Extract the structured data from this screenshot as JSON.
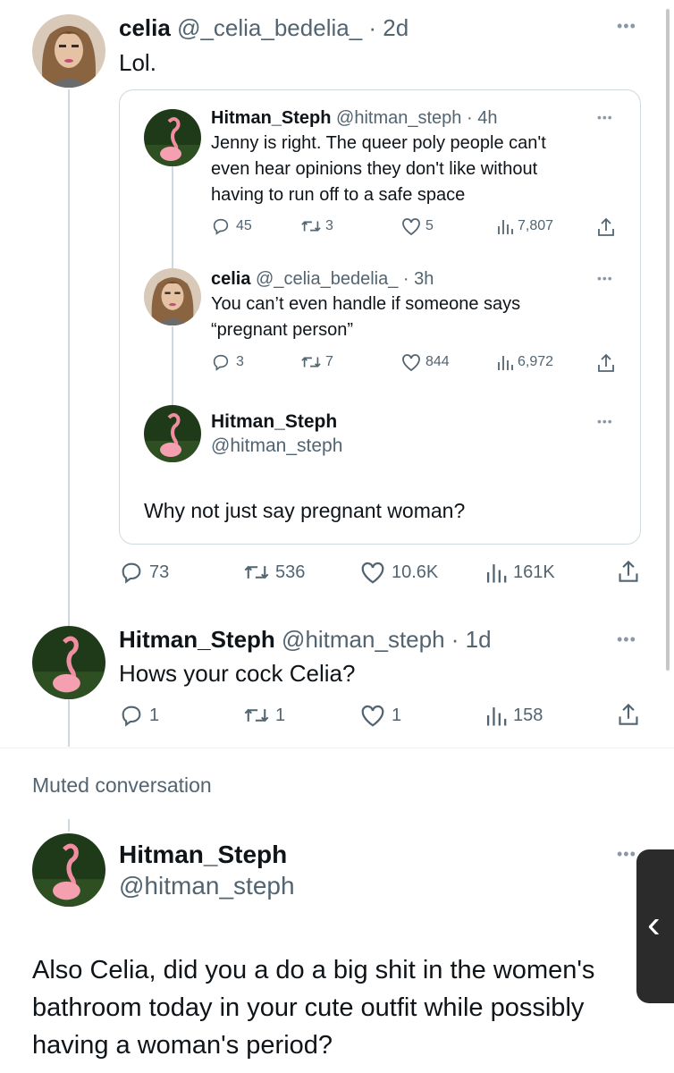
{
  "tweet1": {
    "name": "celia",
    "handle": "@_celia_bedelia_",
    "time": "· 2d",
    "text": "Lol.",
    "actions": {
      "replies": "73",
      "retweets": "536",
      "likes": "10.6K",
      "views": "161K"
    }
  },
  "quote": {
    "post1": {
      "name": "Hitman_Steph",
      "handle": "@hitman_steph",
      "time": "· 4h",
      "text": "Jenny is right. The queer poly people can't even hear opinions they don't like without having to run off to a safe space",
      "actions": {
        "replies": "45",
        "retweets": "3",
        "likes": "5",
        "views": "7,807"
      }
    },
    "post2": {
      "name": "celia",
      "handle": "@_celia_bedelia_",
      "time": "· 3h",
      "text": "You can’t even handle if someone says “pregnant person”",
      "actions": {
        "replies": "3",
        "retweets": "7",
        "likes": "844",
        "views": "6,972"
      }
    },
    "post3": {
      "name": "Hitman_Steph",
      "handle": "@hitman_steph",
      "text": "Why not just say pregnant woman?"
    }
  },
  "tweet2": {
    "name": "Hitman_Steph",
    "handle": "@hitman_steph",
    "time": "· 1d",
    "text": "Hows your cock Celia?",
    "actions": {
      "replies": "1",
      "retweets": "1",
      "likes": "1",
      "views": "158"
    }
  },
  "muted": {
    "label": "Muted conversation"
  },
  "tweet3": {
    "name": "Hitman_Steph",
    "handle": "@hitman_steph",
    "text": "Also Celia, did you a do a big shit in the women's bathroom today in your cute outfit while possibly having a woman's period?"
  },
  "icons": {
    "reply": "reply-icon",
    "retweet": "retweet-icon",
    "like": "heart-icon",
    "views": "views-icon",
    "share": "share-icon",
    "more": "more-icon",
    "back": "chevron-left-icon"
  },
  "colors": {
    "text": "#0f1419",
    "secondary": "#536471",
    "border": "#cfd9de"
  }
}
